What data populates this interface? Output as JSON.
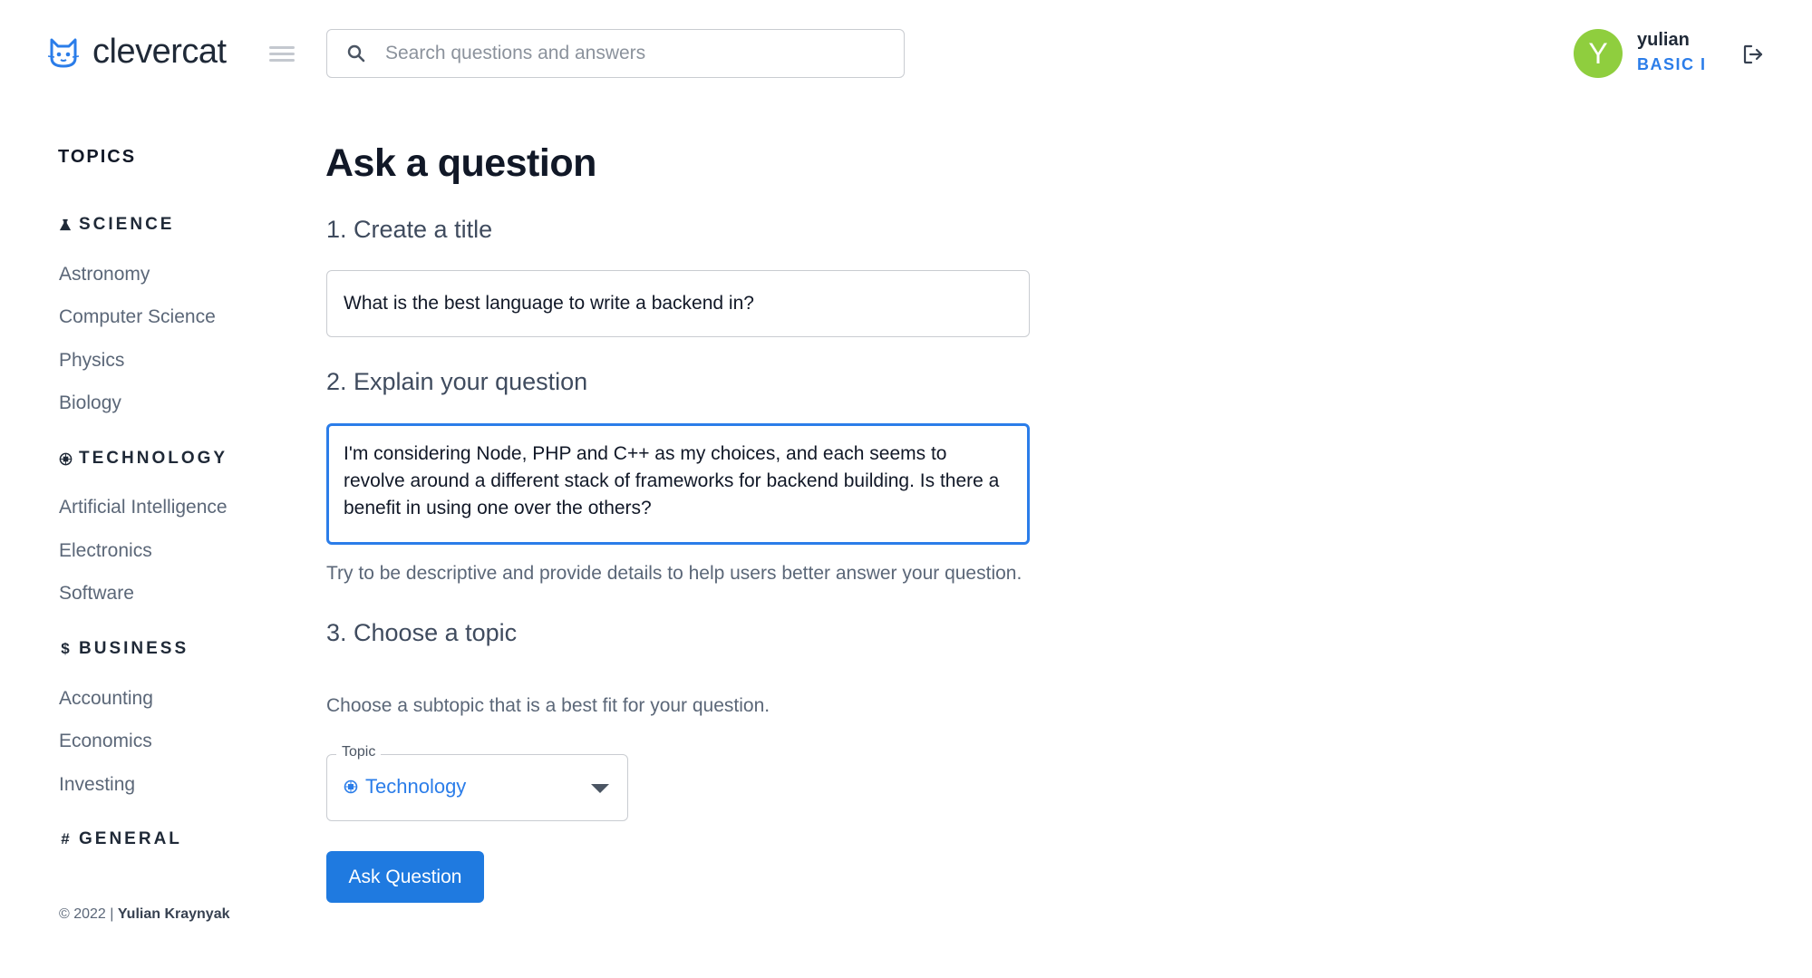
{
  "brand": {
    "name": "clevercat",
    "logo_icon": "cat-icon",
    "accent": "#2b7de9"
  },
  "search": {
    "placeholder": "Search questions and answers",
    "value": ""
  },
  "user": {
    "initial": "Y",
    "name": "yulian",
    "plan": "BASIC I",
    "avatar_color": "#8fce3e"
  },
  "sidebar": {
    "title": "TOPICS",
    "categories": [
      {
        "label": "SCIENCE",
        "icon": "flask-icon",
        "items": [
          "Astronomy",
          "Computer Science",
          "Physics",
          "Biology"
        ]
      },
      {
        "label": "TECHNOLOGY",
        "icon": "chip-icon",
        "items": [
          "Artificial Intelligence",
          "Electronics",
          "Software"
        ]
      },
      {
        "label": "BUSINESS",
        "icon": "dollar-icon",
        "items": [
          "Accounting",
          "Economics",
          "Investing"
        ]
      },
      {
        "label": "GENERAL",
        "icon": "hash-icon",
        "items": []
      }
    ],
    "copyright_prefix": "© 2022 | ",
    "copyright_author": "Yulian Kraynyak"
  },
  "form": {
    "page_title": "Ask a question",
    "step1": "1. Create a title",
    "title_value": "What is the best language to write a backend in?",
    "step2": "2. Explain your question",
    "explain_value": "I'm considering Node, PHP and C++ as my choices, and each seems to revolve around a different stack of frameworks for backend building. Is there a benefit in using one over the others?",
    "helper": "Try to be descriptive and provide details to help users better answer your question.",
    "step3": "3. Choose a topic",
    "choose_hint": "Choose a subtopic that is a best fit for your question.",
    "topic_label": "Topic",
    "topic_value": "Technology",
    "topic_icon": "chip-icon",
    "submit_label": "Ask Question"
  }
}
